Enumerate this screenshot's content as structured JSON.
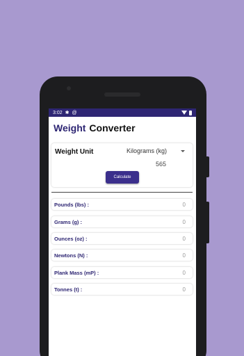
{
  "status": {
    "time": "3:02",
    "icons": [
      "settings-icon",
      "at-icon",
      "wifi-icon",
      "battery-icon"
    ]
  },
  "header": {
    "title_part1": "Weight",
    "title_part2": "Converter"
  },
  "input": {
    "label": "Weight Unit",
    "selected_unit": "Kilograms (kg)",
    "value": "565",
    "calculate_label": "Calculate"
  },
  "results": [
    {
      "label": "Pounds (lbs) :",
      "value": "0"
    },
    {
      "label": "Grams (g) :",
      "value": "0"
    },
    {
      "label": "Ounces (oz) :",
      "value": "0"
    },
    {
      "label": "Newtons (N) :",
      "value": "0"
    },
    {
      "label": "Plank Mass (mP) :",
      "value": "0"
    },
    {
      "label": "Tonnes (t) :",
      "value": "0"
    }
  ],
  "colors": {
    "background": "#a899cf",
    "accent": "#2e2673",
    "button": "#3b2f8c"
  }
}
